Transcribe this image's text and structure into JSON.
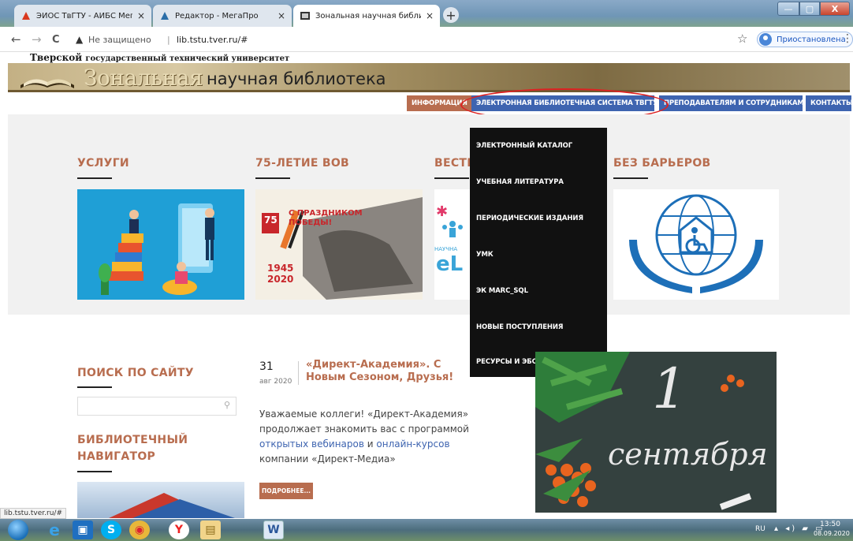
{
  "browser": {
    "tabs": [
      {
        "title": "ЭИОС ТвГТУ - АИБС МегаПро",
        "close": "×"
      },
      {
        "title": "Редактор - МегаПро",
        "close": "×"
      },
      {
        "title": "Зональная научная библиотека",
        "close": "×"
      }
    ],
    "new_tab": "+",
    "back": "←",
    "forward": "→",
    "reload": "C",
    "warning_icon": "▲",
    "security_text": "Не защищено",
    "separator": "|",
    "url": "lib.tstu.tver.ru/#",
    "bookmark_icon": "☆",
    "profile_label": "Приостановлена",
    "menu_icon": "⋮",
    "window_minimize": "—",
    "window_maximize": "▢",
    "window_close": "X"
  },
  "site": {
    "university_prefix": "Тверской",
    "university_rest": "государственный технический университет",
    "library_name_a": "Зональная",
    "library_name_b": "научная библиотека"
  },
  "menu": {
    "info": "ИНФОРМАЦИЯ",
    "els": "ЭЛЕКТРОННАЯ БИБЛИОТЕЧНАЯ СИСТЕМА ТВГТУ",
    "staff": "ПРЕПОДАВАТЕЛЯМ И СОТРУДНИКАМ",
    "contacts": "КОНТАКТЫ"
  },
  "dropdown": [
    "ЭЛЕКТРОННЫЙ КАТАЛОГ",
    "УЧЕБНАЯ ЛИТЕРАТУРА",
    "ПЕРИОДИЧЕСКИЕ ИЗДАНИЯ",
    "УМК",
    "ЭК MARC_SQL",
    "НОВЫЕ ПОСТУПЛЕНИЯ",
    "РЕСУРСЫ И ЭБС"
  ],
  "columns": {
    "services": "УСЛУГИ",
    "vov": "75-ЛЕТИЕ ВОВ",
    "vestnik": "ВЕСТН",
    "barriers": "БЕЗ БАРЬЕРОВ"
  },
  "vov_banner": {
    "line1": "С ПРАЗДНИКОМ",
    "line2": "ПОБЕДЫ!",
    "badge": "75",
    "year_from": "1945",
    "year_to": "2020"
  },
  "elib_banner": {
    "label": "НАУЧНА",
    "logo": "eL"
  },
  "sidebar": {
    "search_title": "ПОИСК ПО САЙТУ",
    "search_icon": "⚲",
    "navigator_title": "БИБЛИОТЕЧНЫЙ НАВИГАТОР"
  },
  "news": {
    "day": "31",
    "month": "авг 2020",
    "title": "«Директ-Академия». С Новым Сезоном, Друзья!",
    "text_1": "Уважаемые коллеги! «Директ-Академия» продолжает знакомить вас с программой ",
    "link_1": "открытых вебинаров",
    "text_2": " и ",
    "link_2": "онлайн-курсов",
    "text_3": " компании «Директ-Медиа»",
    "more": "ПОДРОБНЕЕ..."
  },
  "september_image": {
    "number": "1",
    "word": "сентября"
  },
  "status_url": "lib.tstu.tver.ru/#",
  "taskbar": {
    "lang": "RU",
    "tray": "▴ ◂) ▰ ▭",
    "time": "13:50",
    "date": "08.09.2020",
    "apps": [
      "e",
      "▣",
      "S",
      "◉",
      "Y",
      "▤",
      "W"
    ]
  },
  "colors": {
    "accent_brown": "#b86d4f",
    "nav_blue": "#3e64b0",
    "dropdown_bg": "#111111",
    "highlight_red": "#dd2222"
  }
}
